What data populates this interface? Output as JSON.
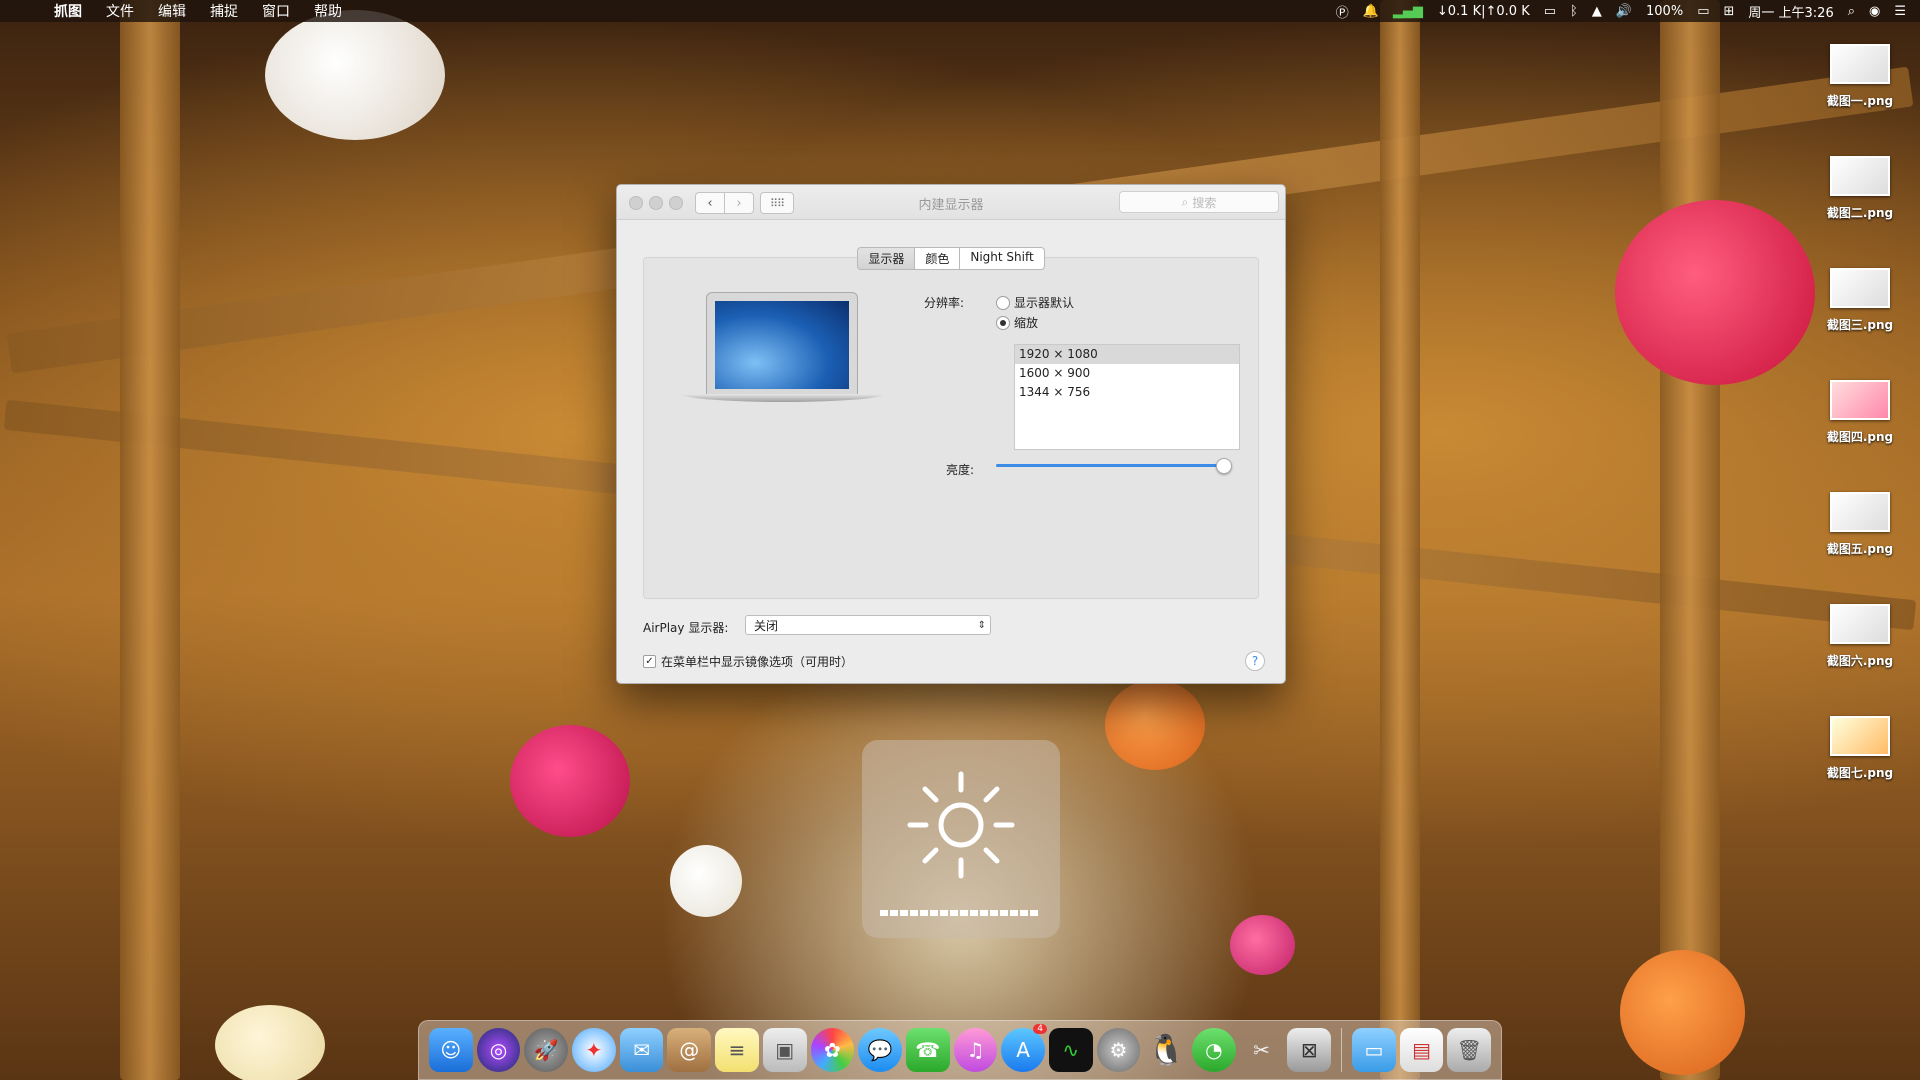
{
  "menubar": {
    "app": "抓图",
    "menus": [
      "文件",
      "编辑",
      "捕捉",
      "窗口",
      "帮助"
    ],
    "status": {
      "network": "↓0.1 K|↑0.0 K",
      "battery": "100%",
      "clock": "周一 上午3:26"
    }
  },
  "desktop_files": [
    "截图一.png",
    "截图二.png",
    "截图三.png",
    "截图四.png",
    "截图五.png",
    "截图六.png",
    "截图七.png"
  ],
  "window": {
    "title": "内建显示器",
    "search_placeholder": "搜索",
    "tabs": [
      "显示器",
      "颜色",
      "Night Shift"
    ],
    "resolution_label": "分辨率:",
    "resolution_options": [
      "显示器默认",
      "缩放"
    ],
    "resolution_selected": "缩放",
    "resolutions": [
      "1920 × 1080",
      "1600 × 900",
      "1344 × 756"
    ],
    "resolution_current": "1920 × 1080",
    "brightness_label": "亮度:",
    "brightness_level": 0.97,
    "airplay_label": "AirPlay 显示器:",
    "airplay_value": "关闭",
    "mirror_label": "在菜单栏中显示镜像选项（可用时）",
    "mirror_checked": true,
    "help": "?"
  },
  "hud": {
    "type": "brightness",
    "segments": 16,
    "filled": 16
  },
  "dock": {
    "icons": [
      "finder-icon",
      "siri-icon",
      "launchpad-icon",
      "safari-icon",
      "mail-icon",
      "contacts-icon",
      "notes-icon",
      "preview-icon",
      "photos-icon",
      "messages-icon",
      "facetime-icon",
      "itunes-icon",
      "app-store-icon",
      "activity-monitor-icon",
      "system-preferences-icon",
      "qq-icon",
      "wechat-icon",
      "screenshot-app-icon",
      "archive-icon",
      "folder-icon",
      "screenshot-file-icon",
      "trash-icon"
    ],
    "app_store_badge": "4"
  }
}
